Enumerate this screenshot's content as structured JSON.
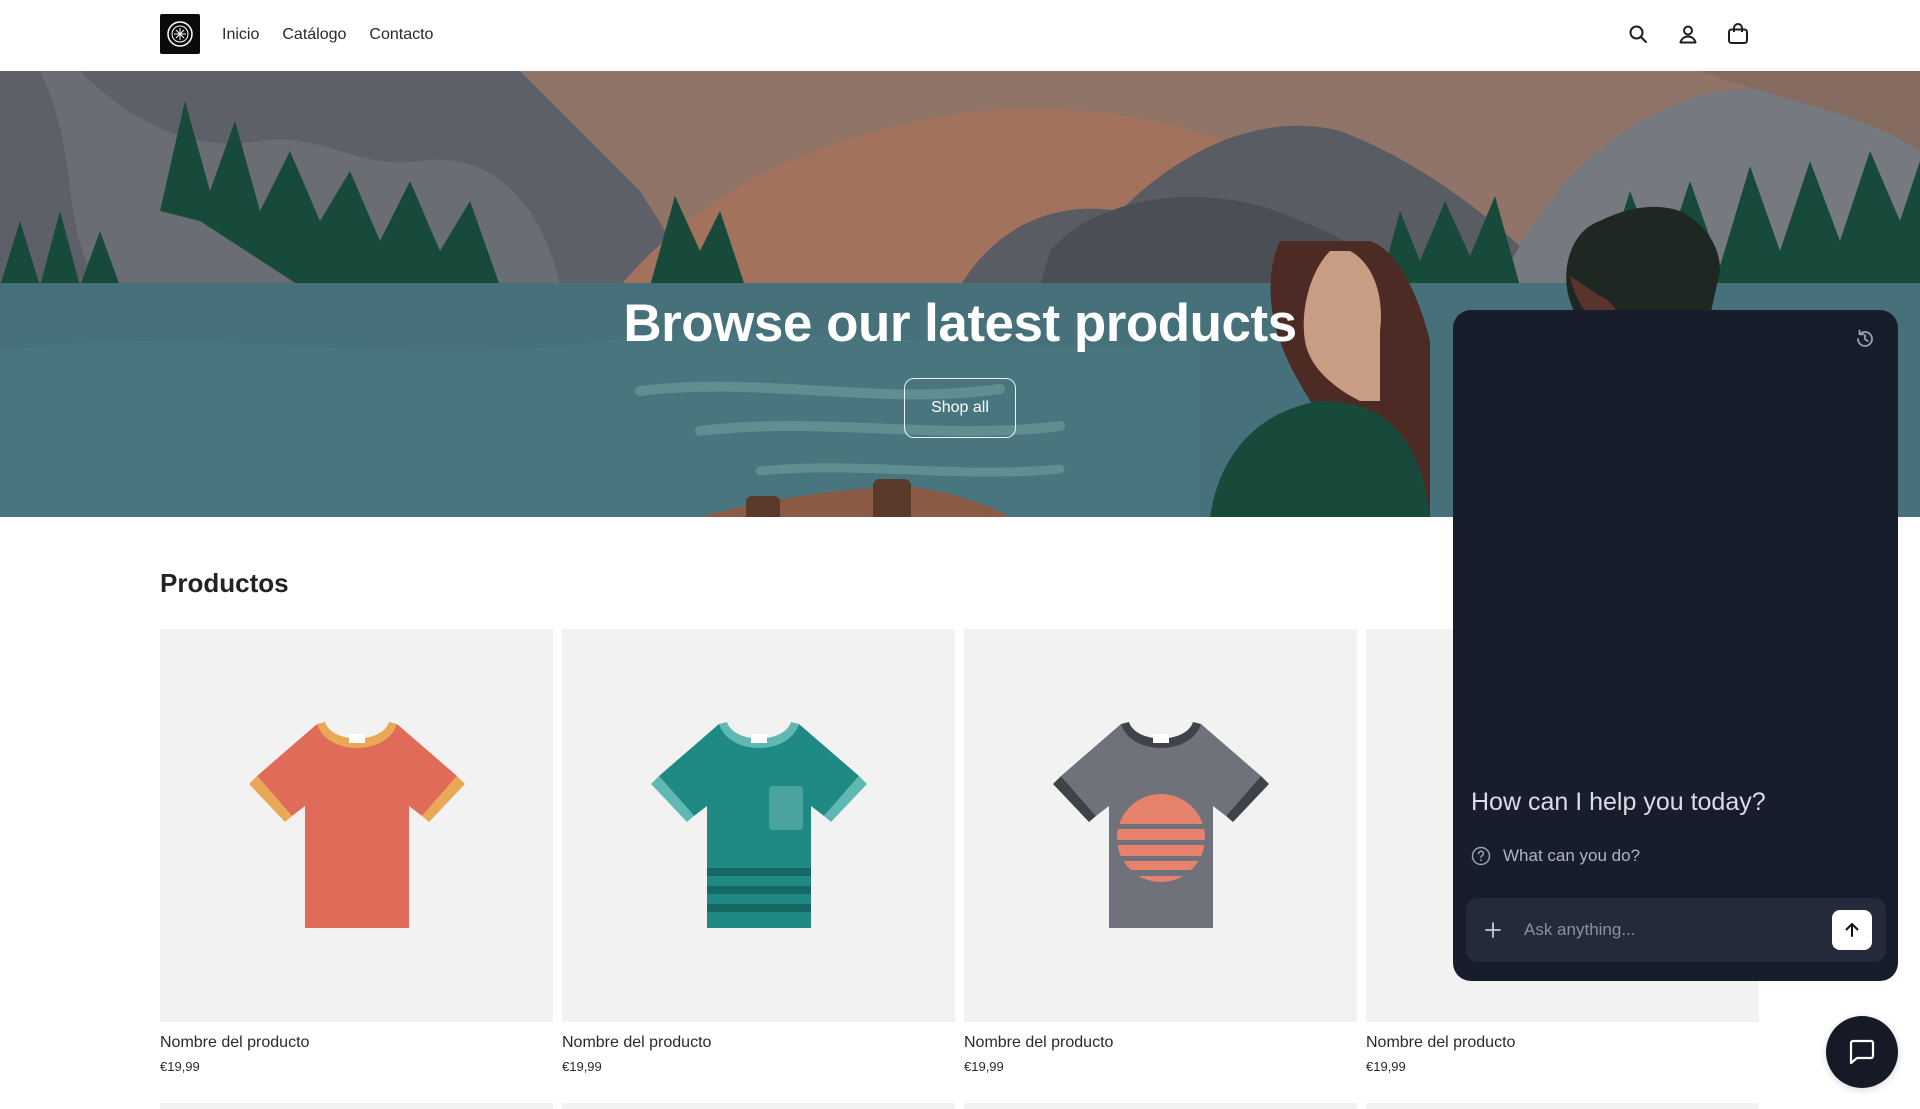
{
  "header": {
    "logo": "store-logo",
    "nav": [
      "Inicio",
      "Catálogo",
      "Contacto"
    ],
    "icons": [
      "search-icon",
      "account-icon",
      "cart-icon"
    ]
  },
  "hero": {
    "title": "Browse our latest products",
    "button_label": "Shop all"
  },
  "products": {
    "title": "Productos",
    "items": [
      {
        "name": "Nombre del producto",
        "price": "€19,99",
        "color": "#e06b58",
        "trim": "#e8a855"
      },
      {
        "name": "Nombre del producto",
        "price": "€19,99",
        "color": "#1f8a84",
        "trim": "#5fb8b1"
      },
      {
        "name": "Nombre del producto",
        "price": "€19,99",
        "color": "#6f727a",
        "trim": "#3f4248"
      },
      {
        "name": "Nombre del producto",
        "price": "€19,99",
        "color": "#e06b58",
        "trim": "#e8a855"
      }
    ]
  },
  "chat": {
    "history_icon": "history-icon",
    "greeting": "How can I help you today?",
    "suggestion": "What can you do?",
    "input_placeholder": "Ask anything...",
    "plus_icon": "plus-icon",
    "send_icon": "arrow-up-icon",
    "fab_icon": "chat-bubble-icon"
  },
  "colors": {
    "chat_bg": "#181d2b",
    "hero_water": "#46707a",
    "card_bg": "#f2f2f2"
  }
}
